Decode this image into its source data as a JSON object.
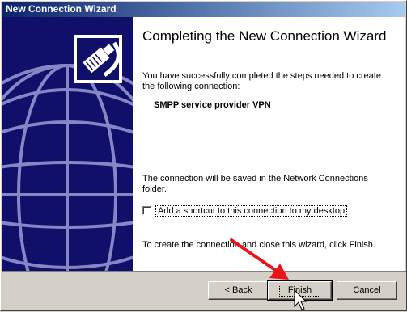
{
  "window": {
    "title": "New Connection Wizard"
  },
  "content": {
    "heading": "Completing the New Connection Wizard",
    "description": "You have successfully completed the steps needed to create the following connection:",
    "connection_name": "SMPP service provider VPN",
    "saved_note": "The connection will be saved in the Network Connections folder.",
    "shortcut_checkbox": {
      "label": "Add a shortcut to this connection to my desktop",
      "checked": false
    },
    "finish_instruction": "To create the connection and close this wizard, click Finish."
  },
  "buttons": {
    "back": "< Back",
    "finish": "Finish",
    "cancel": "Cancel"
  },
  "colors": {
    "title_bar_start": "#0a246a",
    "side_panel": "#10106b",
    "annotation_arrow": "#e8141b"
  },
  "icons": [
    "network-cable-icon",
    "globe-graphic",
    "mouse-cursor-icon"
  ]
}
